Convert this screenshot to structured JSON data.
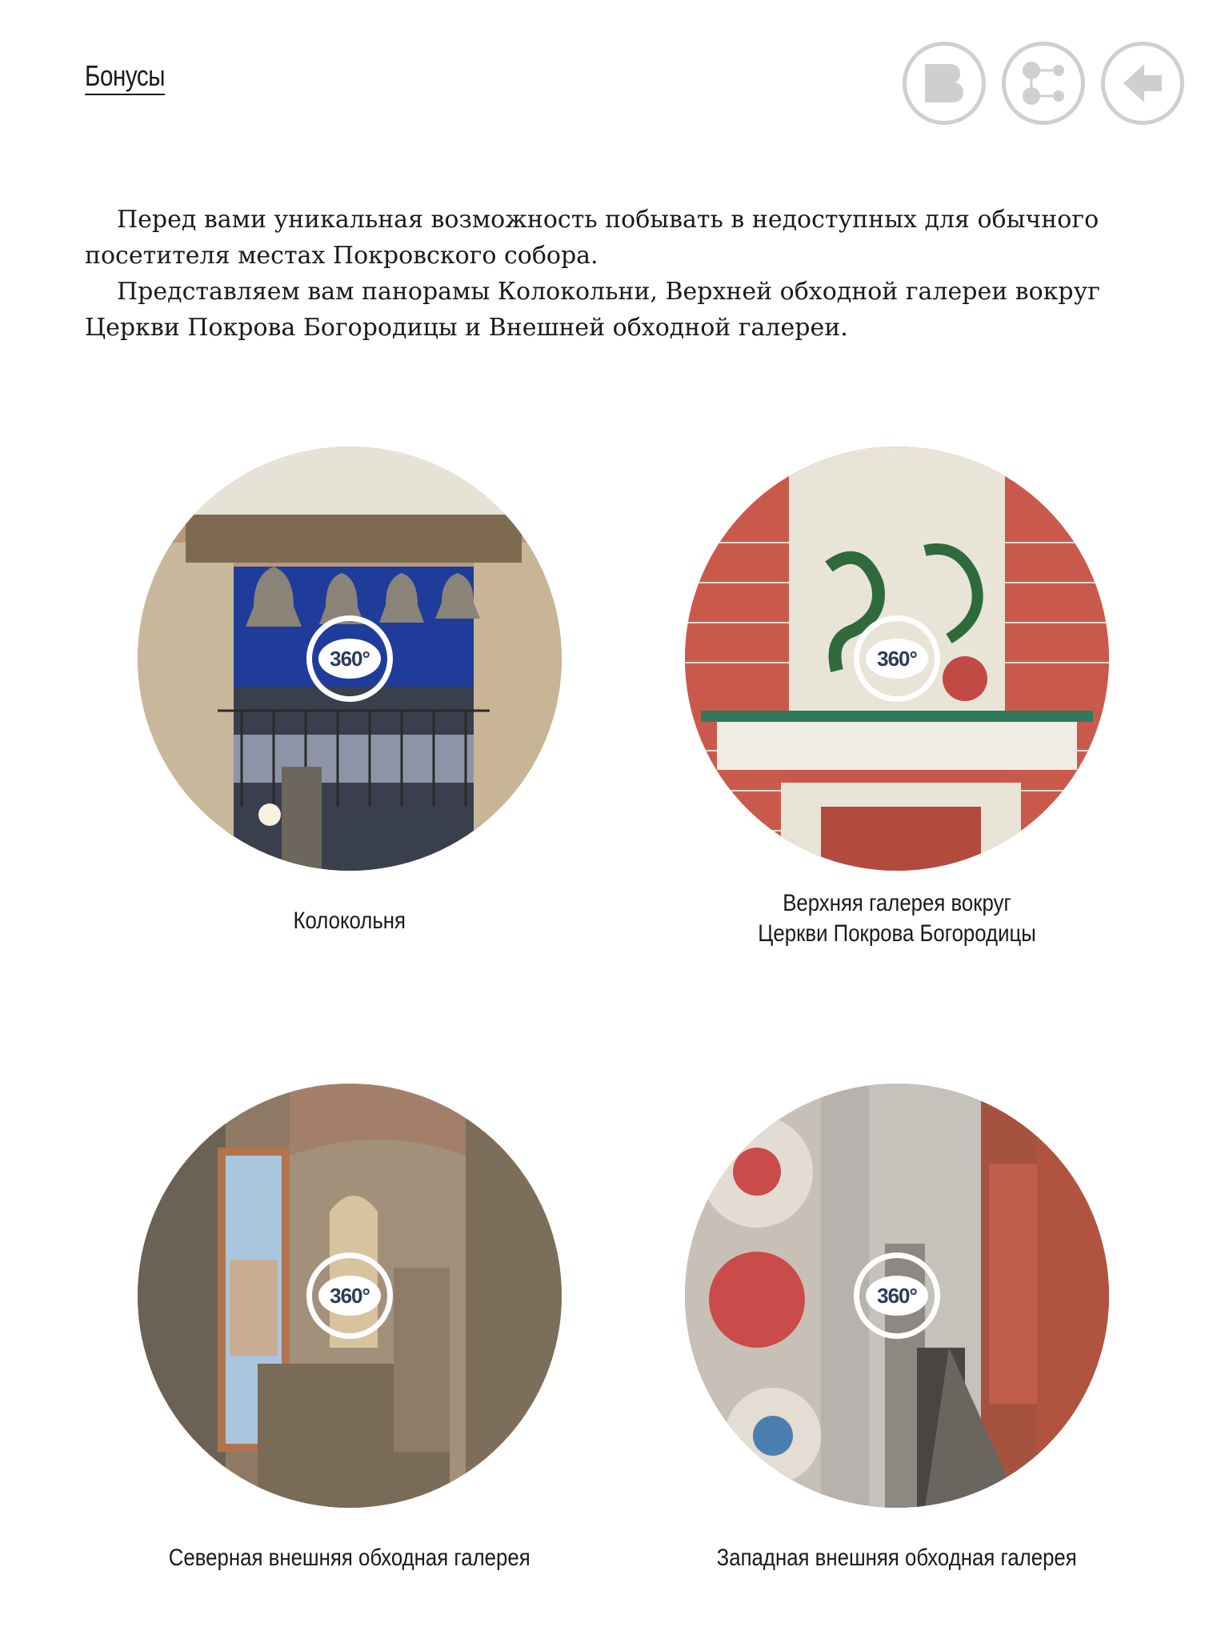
{
  "header": {
    "title": "Бонусы"
  },
  "intro": {
    "paragraph_1": "Перед вами уникальная возможность побывать в недоступных для обычного посетителя местах Покровского собора.",
    "paragraph_2": "Представляем вам панорамы Колокольни, Верхней обходной галереи вокруг Церкви Покрова Богородицы и Внешней обходной галереи."
  },
  "nav": {
    "buttons": [
      {
        "icon": "book-icon"
      },
      {
        "icon": "share-icon"
      },
      {
        "icon": "back-arrow-icon"
      }
    ]
  },
  "panoramas": [
    {
      "label": "Колокольня",
      "badge": "360°"
    },
    {
      "label": "Верхняя галерея вокруг",
      "label_line2": "Церкви Покрова Богородицы",
      "badge": "360°"
    },
    {
      "label": "Северная внешняя обходная галерея",
      "badge": "360°"
    },
    {
      "label": "Западная внешняя обходная галерея",
      "badge": "360°"
    }
  ]
}
